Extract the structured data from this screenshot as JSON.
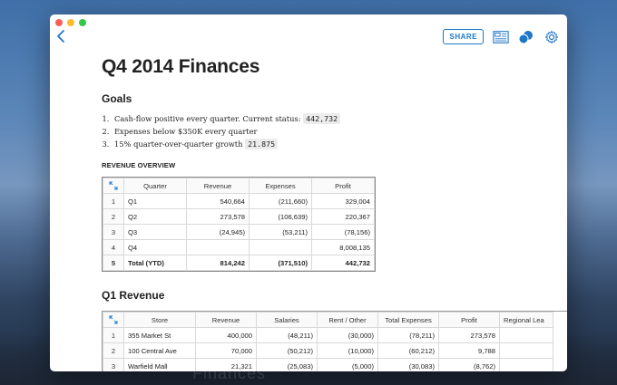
{
  "toolbar": {
    "share_label": "SHARE"
  },
  "doc": {
    "title": "Q4 2014 Finances",
    "goals_heading": "Goals",
    "goals": [
      {
        "text": "Cash-flow positive every quarter. Current status:",
        "code": "442,732"
      },
      {
        "text": "Expenses below $350K every quarter",
        "code": ""
      },
      {
        "text": "15% quarter-over-quarter growth",
        "code": "21.875"
      }
    ],
    "revenue_overview_caption": "REVENUE OVERVIEW",
    "q1_heading": "Q1 Revenue"
  },
  "overview_table": {
    "columns": [
      "Quarter",
      "Revenue",
      "Expenses",
      "Profit"
    ],
    "rows": [
      {
        "n": "1",
        "cells": [
          "Q1",
          "540,664",
          "(211,660)",
          "329,004"
        ]
      },
      {
        "n": "2",
        "cells": [
          "Q2",
          "273,578",
          "(106,639)",
          "220,367"
        ]
      },
      {
        "n": "3",
        "cells": [
          "Q3",
          "(24,945)",
          "(53,211)",
          "(78,156)"
        ]
      },
      {
        "n": "4",
        "cells": [
          "Q4",
          "",
          "",
          "8,008,135"
        ]
      },
      {
        "n": "5",
        "cells": [
          "Total (YTD)",
          "814,242",
          "(371,510)",
          "442,732"
        ]
      }
    ]
  },
  "q1_table": {
    "columns": [
      "Store",
      "Revenue",
      "Salaries",
      "Rent / Other",
      "Total Expenses",
      "Profit",
      "Regional Lea"
    ],
    "rows": [
      {
        "n": "1",
        "cells": [
          "355 Market St",
          "400,000",
          "(48,211)",
          "(30,000)",
          "(78,211)",
          "273,578",
          ""
        ]
      },
      {
        "n": "2",
        "cells": [
          "100 Central Ave",
          "70,000",
          "(50,212)",
          "(10,000)",
          "(60,212)",
          "9,788",
          ""
        ]
      },
      {
        "n": "3",
        "cells": [
          "Warfield Mall",
          "21,321",
          "(25,083)",
          "(5,000)",
          "(30,083)",
          "(8,762)",
          ""
        ]
      }
    ]
  },
  "background": {
    "caption": "Finances"
  }
}
